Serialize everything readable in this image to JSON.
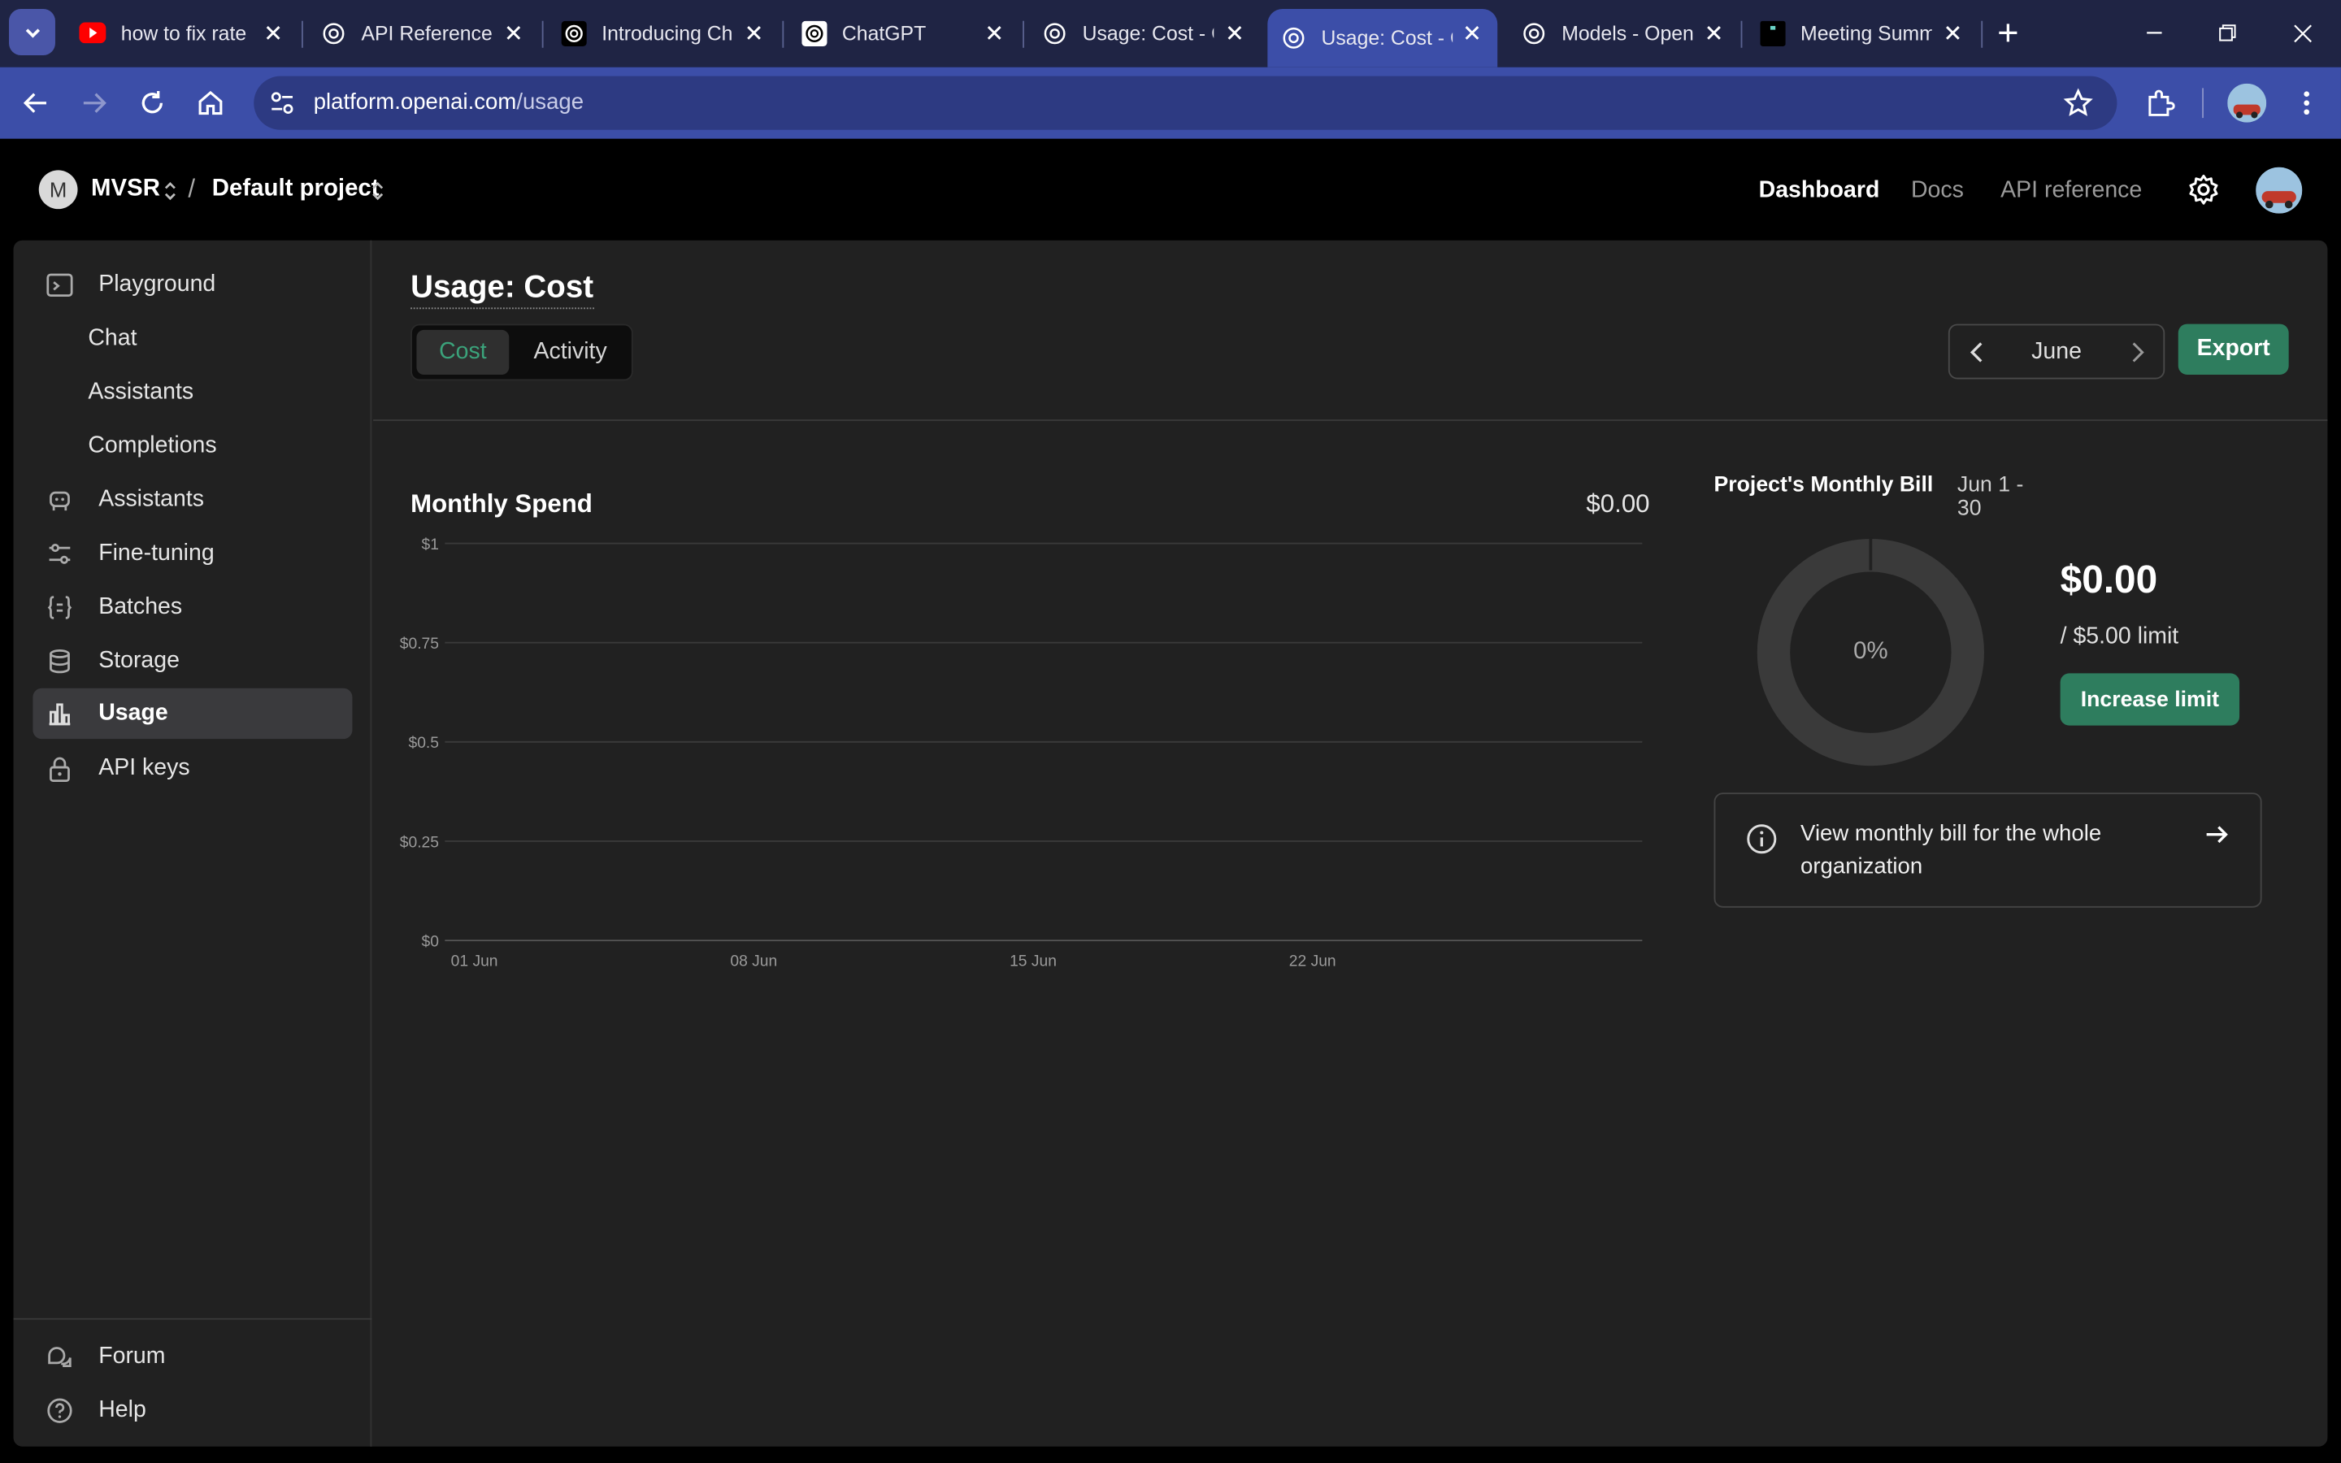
{
  "browser": {
    "tabs": [
      {
        "title": "how to fix rate",
        "favicon": "youtube-icon"
      },
      {
        "title": "API Reference",
        "favicon": "openai-icon"
      },
      {
        "title": "Introducing Ch",
        "favicon": "openai-icon"
      },
      {
        "title": "ChatGPT",
        "favicon": "openai-icon"
      },
      {
        "title": "Usage: Cost - C",
        "favicon": "openai-icon"
      },
      {
        "title": "Usage: Cost - C",
        "favicon": "openai-icon",
        "active": true
      },
      {
        "title": "Models - Open",
        "favicon": "openai-icon"
      },
      {
        "title": "Meeting Summ",
        "favicon": "app-icon"
      }
    ],
    "url_host": "platform.openai.com",
    "url_path": "/usage"
  },
  "topnav": {
    "org_initial": "M",
    "org_name": "MVSR",
    "separator": "/",
    "project_name": "Default project",
    "links": {
      "dashboard": "Dashboard",
      "docs": "Docs",
      "api_reference": "API reference"
    }
  },
  "sidebar": {
    "items": [
      {
        "label": "Playground",
        "icon": "terminal-icon"
      },
      {
        "label": "Chat"
      },
      {
        "label": "Assistants"
      },
      {
        "label": "Completions"
      },
      {
        "label": "Assistants",
        "icon": "robot-icon"
      },
      {
        "label": "Fine-tuning",
        "icon": "sliders-icon"
      },
      {
        "label": "Batches",
        "icon": "braces-icon"
      },
      {
        "label": "Storage",
        "icon": "database-icon"
      },
      {
        "label": "Usage",
        "icon": "bar-chart-icon",
        "active": true
      },
      {
        "label": "API keys",
        "icon": "lock-icon"
      }
    ],
    "bottom": [
      {
        "label": "Forum",
        "icon": "chat-bubbles-icon"
      },
      {
        "label": "Help",
        "icon": "help-icon"
      }
    ]
  },
  "main": {
    "title": "Usage: Cost",
    "tabs": {
      "cost": "Cost",
      "activity": "Activity"
    },
    "month": "June",
    "export_label": "Export"
  },
  "monthly_spend": {
    "title": "Monthly Spend",
    "total": "$0.00"
  },
  "chart_data": {
    "type": "bar",
    "title": "Monthly Spend",
    "xlabel": "",
    "ylabel": "",
    "y_ticks": [
      "$1",
      "$0.75",
      "$0.5",
      "$0.25",
      "$0"
    ],
    "x_ticks": [
      "01 Jun",
      "08 Jun",
      "15 Jun",
      "22 Jun"
    ],
    "ylim": [
      0,
      1
    ],
    "grid": true,
    "series": [
      {
        "values": []
      }
    ]
  },
  "bill": {
    "title": "Project's Monthly Bill",
    "range": "Jun 1 - 30",
    "percent_label": "0%",
    "percent_used": 0,
    "amount": "$0.00",
    "limit": "/ $5.00 limit",
    "increase_label": "Increase limit",
    "org_bill_link": "View monthly bill for the whole organization"
  },
  "colors": {
    "accent_green": "#2e7d5e",
    "active_tab_text": "#3ba37b",
    "browser_blue": "#3c4ea8"
  }
}
